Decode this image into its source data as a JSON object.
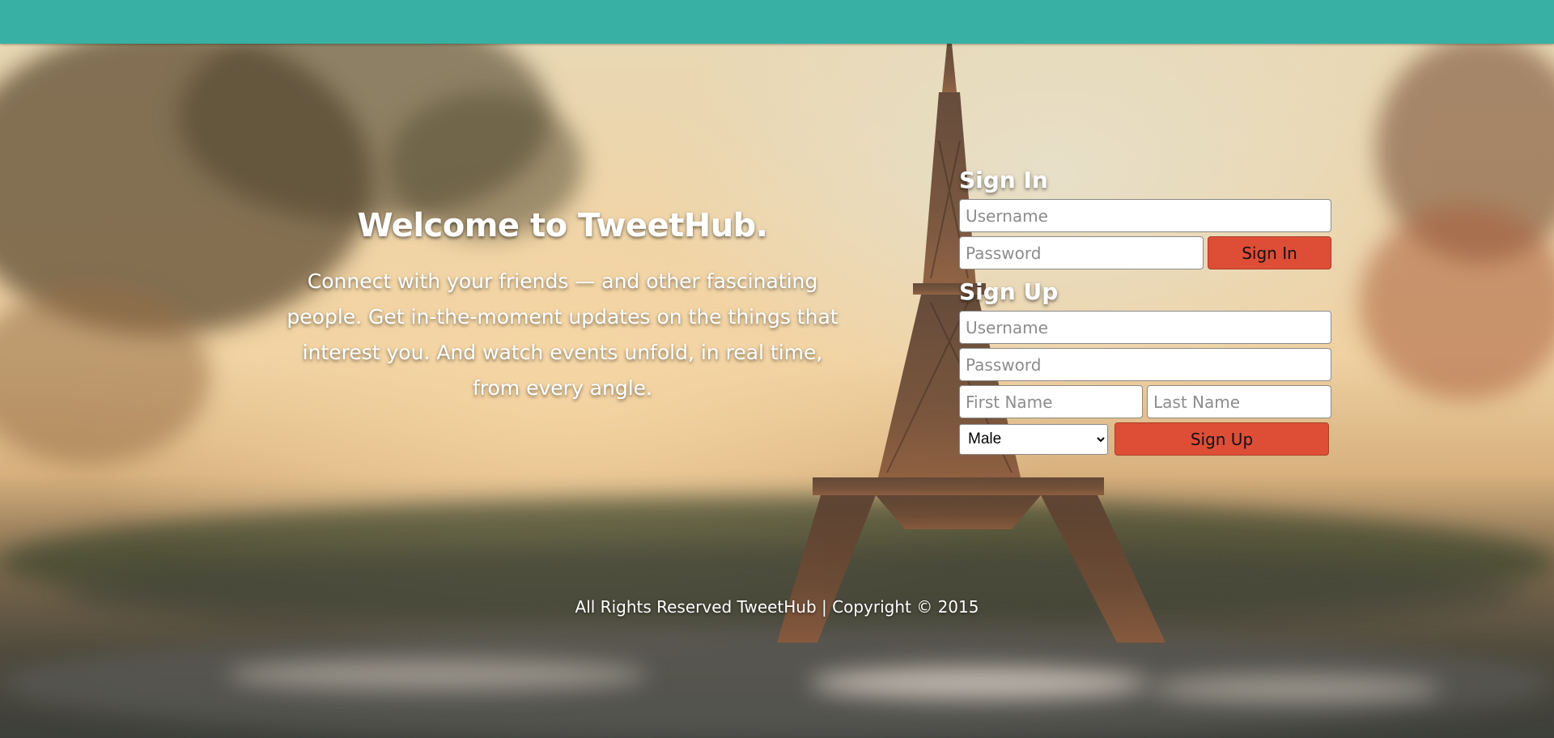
{
  "hero": {
    "title": "Welcome to TweetHub.",
    "description": "Connect with your friends — and other fascinating people. Get in-the-moment updates on the things that interest you. And watch events unfold, in real time, from every angle."
  },
  "sign_in": {
    "heading": "Sign In",
    "username_placeholder": "Username",
    "password_placeholder": "Password",
    "button_label": "Sign In"
  },
  "sign_up": {
    "heading": "Sign Up",
    "username_placeholder": "Username",
    "password_placeholder": "Password",
    "first_name_placeholder": "First Name",
    "last_name_placeholder": "Last Name",
    "gender_selected": "Male",
    "button_label": "Sign Up"
  },
  "footer": {
    "text": "All Rights Reserved TweetHub | Copyright © 2015"
  },
  "colors": {
    "topbar": "#38b0a4",
    "button": "#de4d35"
  }
}
